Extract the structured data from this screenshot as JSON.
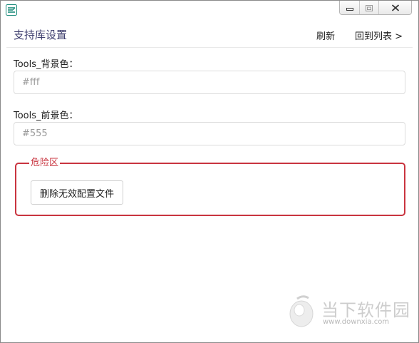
{
  "page": {
    "title": "支持库设置",
    "refresh_label": "刷新",
    "back_label": "回到列表 >"
  },
  "fields": [
    {
      "label": "Tools_背景色：",
      "placeholder": "#fff",
      "value": ""
    },
    {
      "label": "Tools_前景色：",
      "placeholder": "#555",
      "value": ""
    }
  ],
  "danger_zone": {
    "legend": "危险区",
    "button_label": "删除无效配置文件"
  },
  "watermark": {
    "brand": "当下软件园",
    "url": "www.downxia.com"
  },
  "icons": {
    "app": "app-logo-icon",
    "minimize": "minimize-icon",
    "maximize": "maximize-icon",
    "close": "close-icon",
    "watermark": "downxia-logo-icon"
  },
  "colors": {
    "title": "#3e3e6e",
    "danger": "#c9343f",
    "app_icon": "#1a8a7a",
    "input_border": "#dcdcdc"
  }
}
